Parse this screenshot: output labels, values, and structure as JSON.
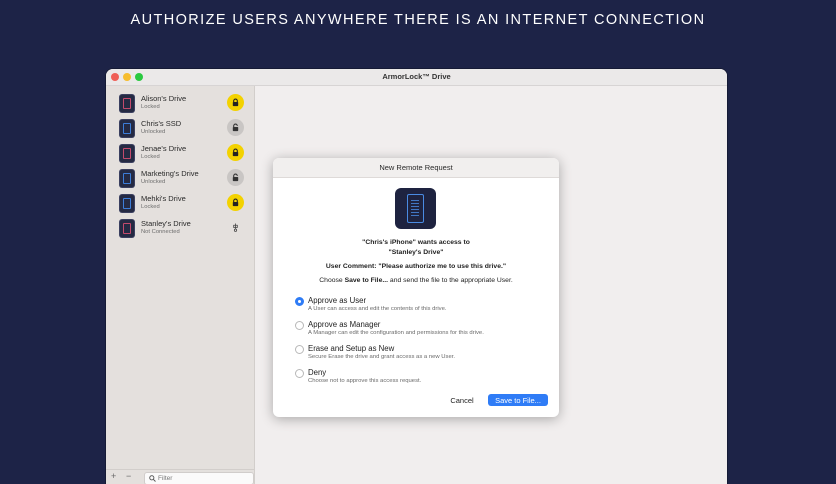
{
  "headline": "AUTHORIZE USERS ANYWHERE THERE IS AN INTERNET CONNECTION",
  "window": {
    "title": "ArmorLock™ Drive"
  },
  "sidebar": {
    "drives": [
      {
        "name": "Alison's Drive",
        "status": "Locked",
        "icon": "lock-icon"
      },
      {
        "name": "Chris's SSD",
        "status": "Unlocked",
        "icon": "unlock-icon"
      },
      {
        "name": "Jenae's Drive",
        "status": "Locked",
        "icon": "lock-icon"
      },
      {
        "name": "Marketing's Drive",
        "status": "Unlocked",
        "icon": "unlock-icon"
      },
      {
        "name": "Mehki's Drive",
        "status": "Locked",
        "icon": "lock-icon"
      },
      {
        "name": "Stanley's Drive",
        "status": "Not Connected",
        "icon": "usb-icon"
      }
    ],
    "footer": {
      "add": "+",
      "remove": "−",
      "filter_placeholder": "Filter"
    }
  },
  "dialog": {
    "title": "New Remote Request",
    "request_line1": "\"Chris's iPhone\" wants access to",
    "request_line2": "\"Stanley's Drive\"",
    "comment_label": "User Comment:",
    "comment_text": "\"Please authorize me to use this drive.\"",
    "instruction_prefix": "Choose",
    "instruction_bold": "Save to File...",
    "instruction_suffix": "and send the file to the appropriate User.",
    "options": [
      {
        "label": "Approve as User",
        "description": "A User can access and edit the contents of this drive.",
        "selected": true
      },
      {
        "label": "Approve as Manager",
        "description": "A Manager can edit the configuration and permissions for this drive.",
        "selected": false
      },
      {
        "label": "Erase and Setup as New",
        "description": "Secure Erase the drive and grant access as a new User.",
        "selected": false
      },
      {
        "label": "Deny",
        "description": "Choose not to approve this access request.",
        "selected": false
      }
    ],
    "cancel_label": "Cancel",
    "save_label": "Save to File..."
  },
  "colors": {
    "background": "#1d2347",
    "accent": "#2f7cf6",
    "lock_yellow": "#f3d200"
  }
}
